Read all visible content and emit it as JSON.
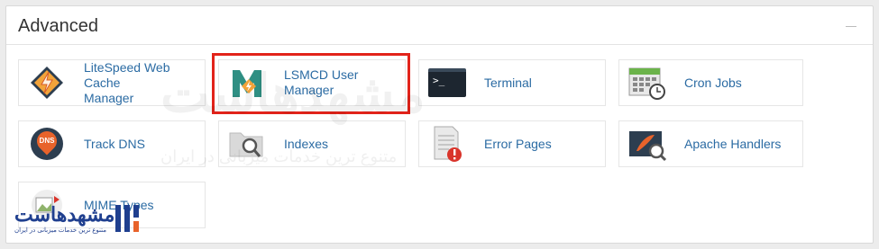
{
  "section": {
    "title": "Advanced"
  },
  "items": [
    {
      "label_line1": "LiteSpeed Web Cache",
      "label_line2": "Manager",
      "icon": "litespeed-icon"
    },
    {
      "label": "LSMCD User Manager",
      "icon": "lsmcd-icon"
    },
    {
      "label": "Terminal",
      "icon": "terminal-icon"
    },
    {
      "label": "Cron Jobs",
      "icon": "calendar-clock-icon"
    },
    {
      "label": "Track DNS",
      "icon": "dns-pin-icon"
    },
    {
      "label": "Indexes",
      "icon": "folder-search-icon"
    },
    {
      "label": "Error Pages",
      "icon": "error-document-icon"
    },
    {
      "label": "Apache Handlers",
      "icon": "feather-search-icon"
    },
    {
      "label": "MIME Types",
      "icon": "mime-image-icon"
    }
  ],
  "terminal_prompt": ">_",
  "dns_badge": "DNS",
  "watermark": {
    "brand": "مشهدهاست",
    "tagline": "متنوع ترین خدمات میزبانی در ایران"
  },
  "colors": {
    "link": "#2b6ba3",
    "highlight": "#e2231a",
    "brand_blue": "#1f3f8f"
  }
}
